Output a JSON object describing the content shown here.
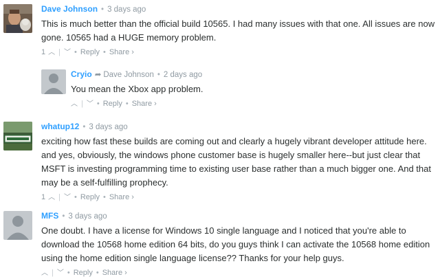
{
  "comments": [
    {
      "author": "Dave Johnson",
      "time": "3 days ago",
      "text": "This is much better than the official build 10565. I had many issues with that one. All issues are now gone. 10565 had a HUGE memory problem.",
      "votes": "1",
      "reply_label": "Reply",
      "share_label": "Share ›"
    },
    {
      "author": "Cryio",
      "parent": "Dave Johnson",
      "time": "2 days ago",
      "text": "You mean the Xbox app problem.",
      "votes": "",
      "reply_label": "Reply",
      "share_label": "Share ›"
    },
    {
      "author": "whatup12",
      "time": "3 days ago",
      "text": "exciting how fast these builds are coming out and clearly a hugely vibrant developer attitude here. and yes, obviously, the windows phone customer base is hugely smaller here--but just clear that MSFT is investing programming time to existing user base rather than a much bigger one. And that may be a self-fulfilling prophecy.",
      "votes": "1",
      "reply_label": "Reply",
      "share_label": "Share ›"
    },
    {
      "author": "MFS",
      "time": "3 days ago",
      "text": "One doubt. I have a license for Windows 10 single language and I noticed that you're able to download the 10568 home edition 64 bits, do you guys think I can activate the 10568 home edition using the home edition single language license?? Thanks for your help guys.",
      "votes": "",
      "reply_label": "Reply",
      "share_label": "Share ›"
    }
  ],
  "icons": {
    "upvote": "chevron-up-icon",
    "downvote": "chevron-down-icon",
    "reply_arrow": "reply-arrow-icon"
  },
  "colors": {
    "author": "#2e9fff",
    "meta": "#8f9aa2",
    "text": "#2a2e2e"
  }
}
